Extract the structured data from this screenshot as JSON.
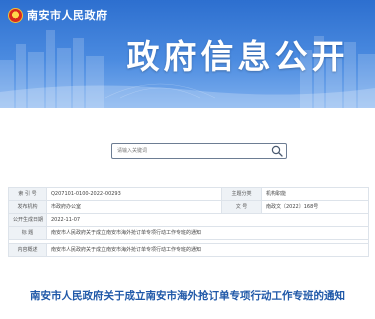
{
  "header": {
    "site_name": "南安市人民政府",
    "banner_title": "政府信息公开"
  },
  "search": {
    "placeholder": "请输入关键词"
  },
  "info": {
    "index_label": "索 引 号",
    "index_value": "Q207101-0100-2022-00293",
    "category_label": "主题分类",
    "category_value": "机构职能",
    "publisher_label": "发布机构",
    "publisher_value": "市政府办公室",
    "docno_label": "文    号",
    "docno_value": "南政文〔2022〕168号",
    "date_label": "公开生成日期",
    "date_value": "2022-11-07",
    "title_label": "标    题",
    "title_value": "南安市人民政府关于成立南安市海外抢订单专项行动工作专班的通知",
    "summary_label": "内容概述",
    "summary_value": "南安市人民政府关于成立南安市海外抢订单专项行动工作专班的通知"
  },
  "article": {
    "title": "南安市人民政府关于成立南安市海外抢订单专项行动工作专班的通知"
  }
}
